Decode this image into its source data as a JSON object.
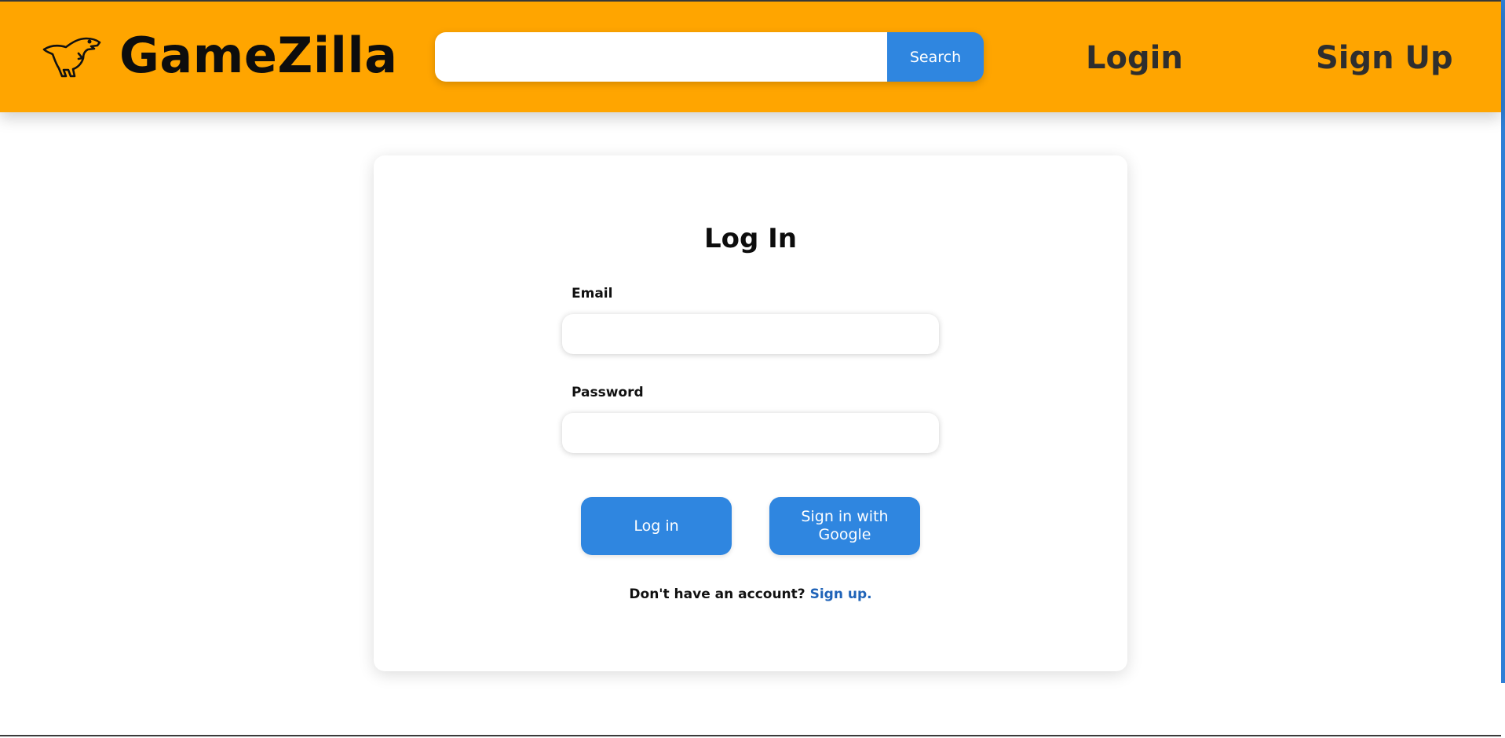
{
  "header": {
    "brand_name": "GameZilla",
    "brand_icon": "dinosaur-icon",
    "search": {
      "value": "",
      "placeholder": "",
      "button_label": "Search"
    },
    "nav": {
      "login_label": "Login",
      "signup_label": "Sign Up"
    }
  },
  "login_form": {
    "title": "Log In",
    "email_label": "Email",
    "email_value": "",
    "password_label": "Password",
    "password_value": "",
    "login_button_label": "Log in",
    "google_button_label": "Sign in with Google",
    "signup_prompt": "Don't have an account?",
    "signup_link_label": "Sign up."
  },
  "colors": {
    "header_background": "#ffa500",
    "accent_blue": "#2f86e0",
    "link_blue": "#1f63b8"
  }
}
